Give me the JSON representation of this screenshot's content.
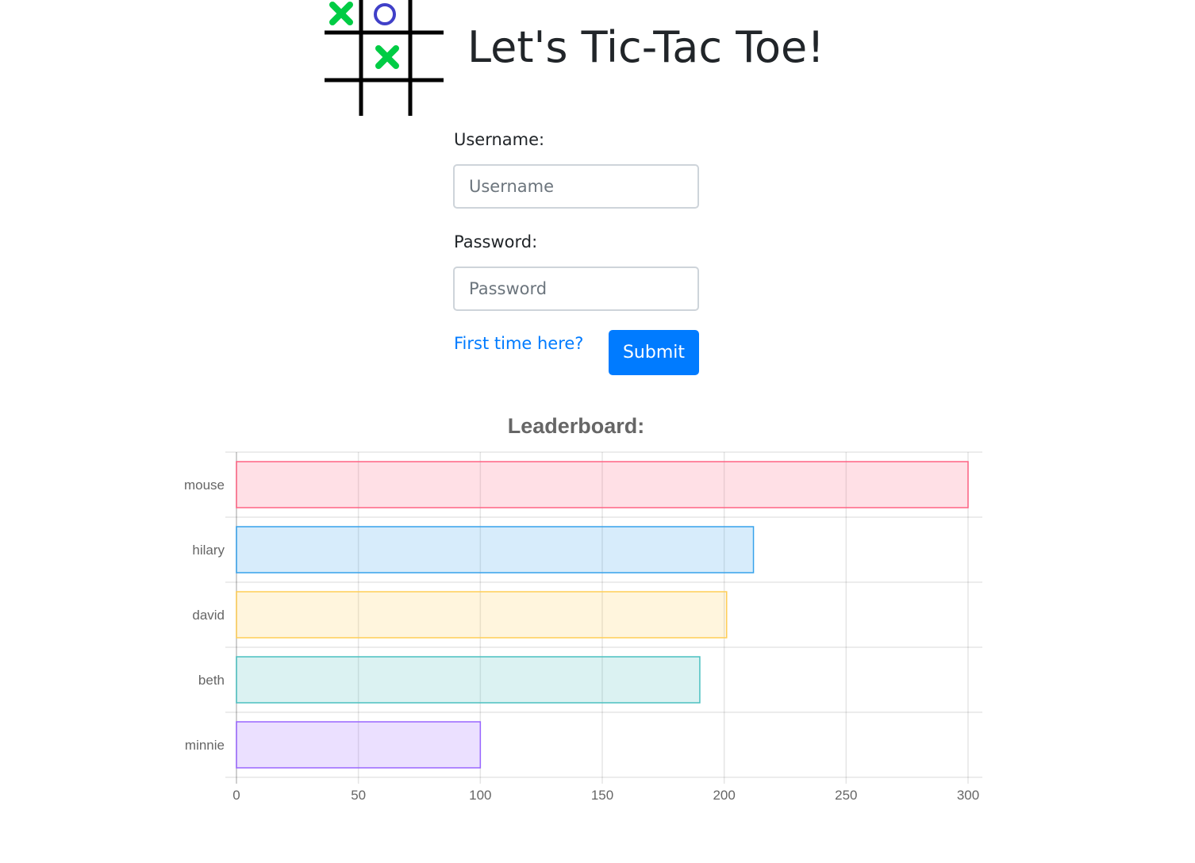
{
  "header": {
    "title": "Let's Tic-Tac Toe!",
    "logo": {
      "icon": "tic-tac-toe-board-icon",
      "x_color": "#00cc44",
      "o_color": "#4040c8",
      "grid_color": "#000000"
    }
  },
  "login_form": {
    "username_label": "Username:",
    "username_placeholder": "Username",
    "username_value": "",
    "password_label": "Password:",
    "password_placeholder": "Password",
    "password_value": "",
    "signup_link": "First time here?",
    "submit_label": "Submit",
    "accent_color": "#007bff"
  },
  "chart_data": {
    "type": "bar",
    "orientation": "horizontal",
    "title": "Leaderboard:",
    "categories": [
      "mouse",
      "hilary",
      "david",
      "beth",
      "minnie"
    ],
    "values": [
      300,
      212,
      201,
      190,
      100
    ],
    "xlim": [
      0,
      300
    ],
    "xticks": [
      0,
      50,
      100,
      150,
      200,
      250,
      300
    ],
    "grid": true,
    "legend": "none",
    "colors": [
      {
        "fill": "rgba(255,99,132,0.2)",
        "stroke": "rgb(255,99,132)"
      },
      {
        "fill": "rgba(54,162,235,0.2)",
        "stroke": "rgb(54,162,235)"
      },
      {
        "fill": "rgba(255,206,86,0.2)",
        "stroke": "rgb(255,206,86)"
      },
      {
        "fill": "rgba(75,192,192,0.2)",
        "stroke": "rgb(75,192,192)"
      },
      {
        "fill": "rgba(153,102,255,0.2)",
        "stroke": "rgb(153,102,255)"
      }
    ]
  }
}
